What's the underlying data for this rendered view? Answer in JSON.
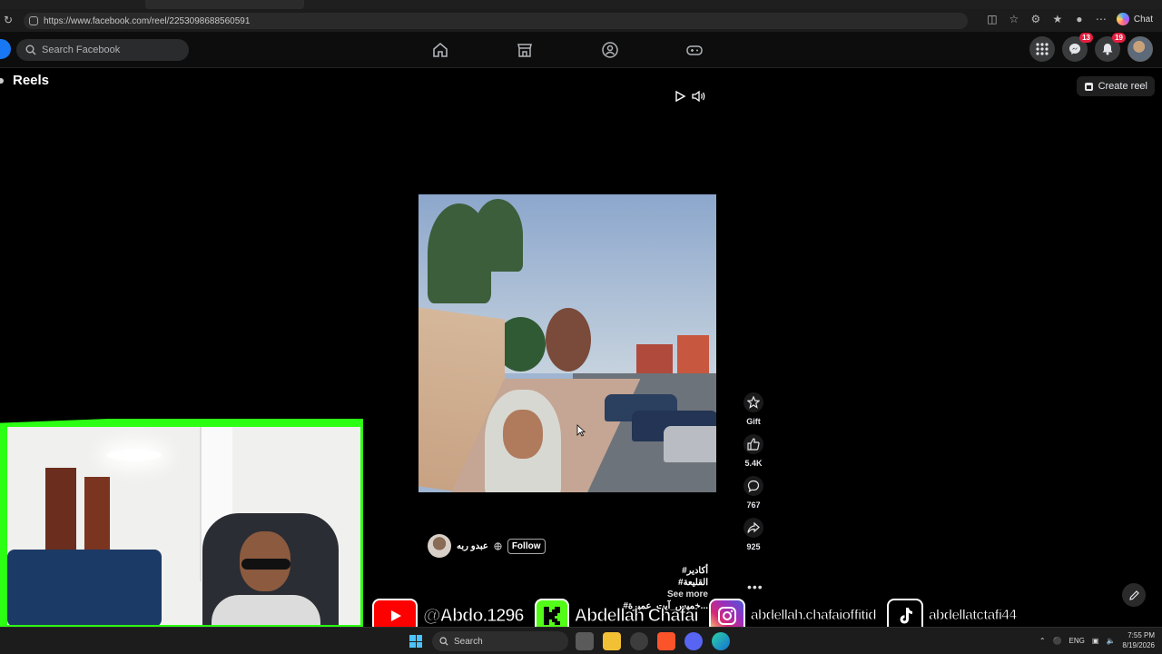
{
  "browser": {
    "url": "https://www.facebook.com/reel/2253098688560591",
    "chat_label": "Chat"
  },
  "facebook": {
    "search_placeholder": "Search Facebook",
    "messenger_badge": "13",
    "notifications_badge": "19"
  },
  "reels": {
    "title": "Reels",
    "create_label": "Create reel"
  },
  "actions": {
    "gift_label": "Gift",
    "likes": "5.4K",
    "comments": "767",
    "shares": "925"
  },
  "post": {
    "author": "عبدو ربه",
    "follow_label": "Follow",
    "caption_line1": "#أكادير",
    "caption_line2": "#القليعة",
    "caption_line3": "#خميس_آيت_عميرة...",
    "see_more": "See more"
  },
  "social": {
    "youtube": "@Abdo.1296",
    "kick": "Abdellah Chafai",
    "instagram": "abdellah.chafaioffitid",
    "tiktok": "abdellatctafi44"
  },
  "taskbar": {
    "search_label": "Search",
    "lang": "ENG",
    "time": "7:55 PM",
    "date": "8/19/2026"
  },
  "colors": {
    "accent": "#1877f2",
    "webcam_frame": "#2cff14",
    "badge": "#e41e3f"
  }
}
